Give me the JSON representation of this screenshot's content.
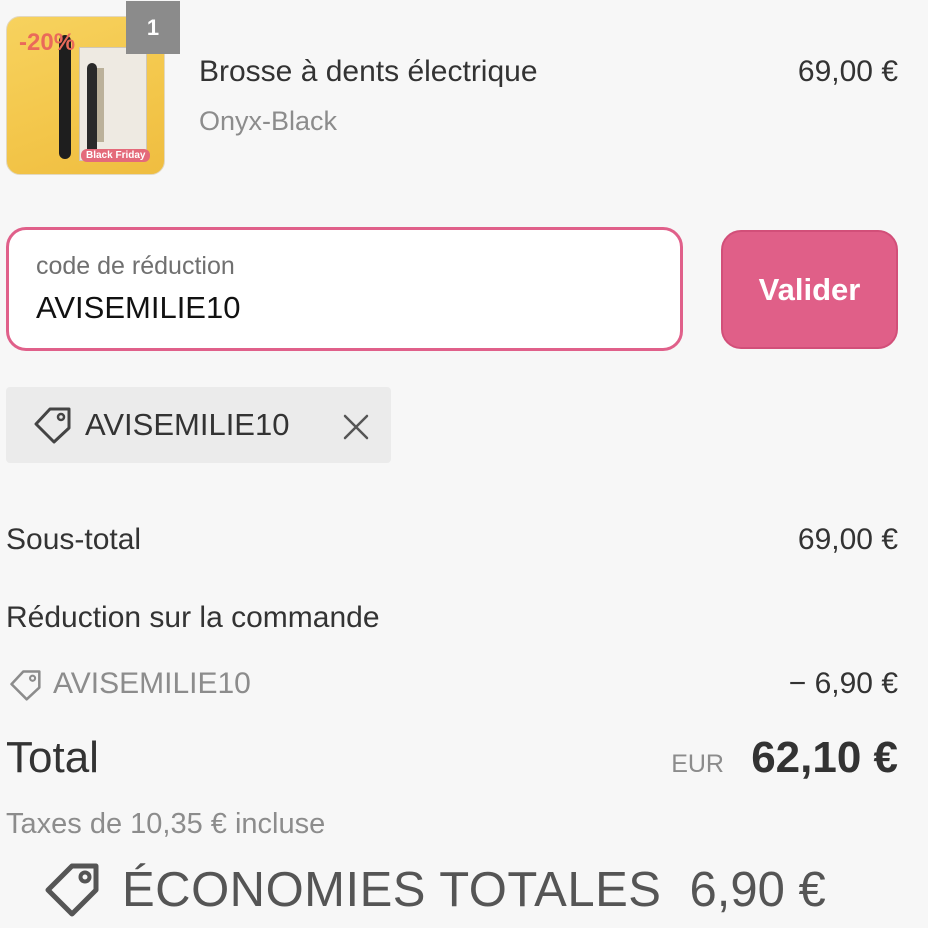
{
  "product": {
    "promo_tag": "-20%",
    "image_badge": "Black Friday",
    "quantity": "1",
    "name": "Brosse à dents électrique",
    "variant": "Onyx-Black",
    "price": "69,00 €"
  },
  "discount_form": {
    "label": "code de réduction",
    "value": "AVISEMILIE10",
    "submit_label": "Valider"
  },
  "applied_code": {
    "code": "AVISEMILIE10",
    "icons": [
      "tag-icon",
      "close-icon"
    ]
  },
  "summary": {
    "subtotal_label": "Sous-total",
    "subtotal_value": "69,00 €",
    "reduction_label": "Réduction sur la commande",
    "reduction_code": "AVISEMILIE10",
    "reduction_value": "− 6,90 €",
    "total_label": "Total",
    "currency": "EUR",
    "total_value": "62,10 €",
    "taxes": "Taxes de 10,35 € incluse"
  },
  "savings": {
    "label": "ÉCONOMIES TOTALES",
    "value": "6,90 €"
  },
  "colors": {
    "accent": "#e05f88",
    "background": "#f7f7f7",
    "chip_background": "#ebebeb"
  }
}
